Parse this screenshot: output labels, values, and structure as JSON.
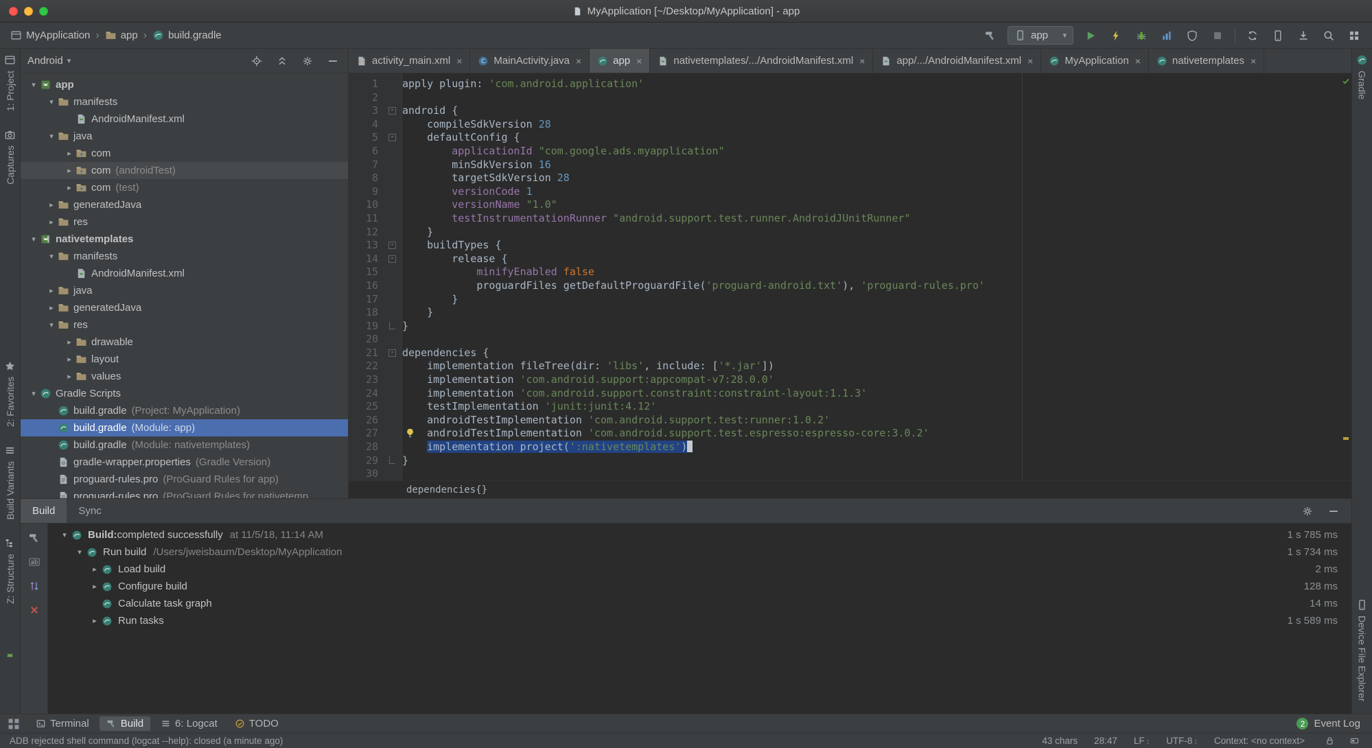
{
  "window": {
    "title": "MyApplication [~/Desktop/MyApplication] - app"
  },
  "colors": {
    "selection": "#214283",
    "tree_selection": "#4b6eaf",
    "run_green": "#5a9e60",
    "error_red": "#c75450",
    "event_badge": "#499c54",
    "string": "#6a8759",
    "keyword": "#cc7832"
  },
  "nav": {
    "crumbs": [
      {
        "label": "MyApplication",
        "icon": "window"
      },
      {
        "label": "app",
        "icon": "folder"
      },
      {
        "label": "build.gradle",
        "icon": "gradle"
      }
    ],
    "run_config": "app",
    "toolbar": [
      {
        "icon": "hammer",
        "name": "build"
      },
      {
        "type": "combo"
      },
      {
        "icon": "play",
        "name": "run"
      },
      {
        "icon": "lightning",
        "name": "apply-changes"
      },
      {
        "icon": "bug",
        "name": "debug"
      },
      {
        "icon": "profiler",
        "name": "profile"
      },
      {
        "icon": "shield",
        "name": "coverage"
      },
      {
        "icon": "stop",
        "name": "stop"
      },
      {
        "type": "sep"
      },
      {
        "icon": "sync",
        "name": "gradle-sync"
      },
      {
        "icon": "device",
        "name": "layout-inspector"
      },
      {
        "icon": "download",
        "name": "sdk-manager"
      },
      {
        "icon": "search",
        "name": "search-everywhere"
      },
      {
        "icon": "grid",
        "name": "project-structure"
      }
    ]
  },
  "left_stripe": {
    "items": [
      {
        "label": "1: Project",
        "icon": "window"
      },
      {
        "label": "Captures",
        "icon": "camera"
      },
      {
        "label": "2: Favorites",
        "icon": "star",
        "gap": true
      },
      {
        "label": "Build Variants",
        "icon": "list"
      },
      {
        "label": "Z: Structure",
        "icon": "structure"
      }
    ],
    "extra_icon": "robot"
  },
  "right_stripe": {
    "items": [
      {
        "label": "Gradle",
        "icon": "gradle"
      },
      {
        "label": "Device File Explorer",
        "icon": "device",
        "bottom": true
      }
    ]
  },
  "project": {
    "mode": "Android",
    "header_icons": [
      {
        "icon": "target",
        "name": "locate-file"
      },
      {
        "icon": "collapseall",
        "name": "collapse-all"
      },
      {
        "icon": "gear",
        "name": "view-options"
      },
      {
        "icon": "hidebar",
        "name": "hide-panel"
      }
    ],
    "tree": [
      {
        "label": "app",
        "icon": "android-module",
        "depth": 0,
        "arrow": "open",
        "bold": true
      },
      {
        "label": "manifests",
        "icon": "folder",
        "depth": 1,
        "arrow": "open"
      },
      {
        "label": "AndroidManifest.xml",
        "icon": "manifest",
        "depth": 2,
        "arrow": "none"
      },
      {
        "label": "java",
        "icon": "folder",
        "depth": 1,
        "arrow": "open"
      },
      {
        "label": "com",
        "icon": "package",
        "depth": 2,
        "arrow": "closed"
      },
      {
        "label": "com",
        "note": "(androidTest)",
        "icon": "package",
        "depth": 2,
        "arrow": "closed",
        "hl": true
      },
      {
        "label": "com",
        "note": "(test)",
        "icon": "package",
        "depth": 2,
        "arrow": "closed"
      },
      {
        "label": "generatedJava",
        "icon": "folder",
        "depth": 1,
        "arrow": "closed"
      },
      {
        "label": "res",
        "icon": "folder",
        "depth": 1,
        "arrow": "closed"
      },
      {
        "label": "nativetemplates",
        "icon": "library-module",
        "depth": 0,
        "arrow": "open",
        "bold": true
      },
      {
        "label": "manifests",
        "icon": "folder",
        "depth": 1,
        "arrow": "open"
      },
      {
        "label": "AndroidManifest.xml",
        "icon": "manifest",
        "depth": 2,
        "arrow": "none"
      },
      {
        "label": "java",
        "icon": "folder",
        "depth": 1,
        "arrow": "closed"
      },
      {
        "label": "generatedJava",
        "icon": "folder",
        "depth": 1,
        "arrow": "closed"
      },
      {
        "label": "res",
        "icon": "folder",
        "depth": 1,
        "arrow": "open"
      },
      {
        "label": "drawable",
        "icon": "folder",
        "depth": 2,
        "arrow": "closed"
      },
      {
        "label": "layout",
        "icon": "folder",
        "depth": 2,
        "arrow": "closed"
      },
      {
        "label": "values",
        "icon": "folder",
        "depth": 2,
        "arrow": "closed"
      },
      {
        "label": "Gradle Scripts",
        "icon": "gradle",
        "depth": 0,
        "arrow": "open"
      },
      {
        "label": "build.gradle",
        "note": "(Project: MyApplication)",
        "icon": "gradle",
        "depth": 1,
        "arrow": "none"
      },
      {
        "label": "build.gradle",
        "note": "(Module: app)",
        "icon": "gradle",
        "depth": 1,
        "arrow": "none",
        "selected": true
      },
      {
        "label": "build.gradle",
        "note": "(Module: nativetemplates)",
        "icon": "gradle",
        "depth": 1,
        "arrow": "none"
      },
      {
        "label": "gradle-wrapper.properties",
        "note": "(Gradle Version)",
        "icon": "wrapper",
        "depth": 1,
        "arrow": "none"
      },
      {
        "label": "proguard-rules.pro",
        "note": "(ProGuard Rules for app)",
        "icon": "profile",
        "depth": 1,
        "arrow": "none"
      },
      {
        "label": "proguard-rules.pro",
        "note": "(ProGuard Rules for nativetemp",
        "icon": "profile",
        "depth": 1,
        "arrow": "none"
      }
    ]
  },
  "editor": {
    "tabs": [
      {
        "label": "activity_main.xml",
        "icon": "xml"
      },
      {
        "label": "MainActivity.java",
        "icon": "java"
      },
      {
        "label": "app",
        "icon": "gradle",
        "active": true
      },
      {
        "label": "nativetemplates/.../AndroidManifest.xml",
        "icon": "manifest"
      },
      {
        "label": "app/.../AndroidManifest.xml",
        "icon": "manifest"
      },
      {
        "label": "MyApplication",
        "icon": "gradle"
      },
      {
        "label": "nativetemplates",
        "icon": "gradle"
      }
    ],
    "breadcrumb": "dependencies{}",
    "code": {
      "lines": [
        {
          "tok": [
            [
              "p",
              "apply plugin: "
            ],
            [
              "s",
              "'com.android.application'"
            ]
          ]
        },
        {
          "tok": []
        },
        {
          "tok": [
            [
              "p",
              "android {"
            ]
          ],
          "fold": true
        },
        {
          "tok": [
            [
              "p",
              "    compileSdkVersion "
            ],
            [
              "n",
              "28"
            ]
          ]
        },
        {
          "tok": [
            [
              "p",
              "    defaultConfig {"
            ]
          ],
          "fold": true
        },
        {
          "tok": [
            [
              "p",
              "        "
            ],
            [
              "f",
              "applicationId "
            ],
            [
              "s",
              "\"com.google.ads.myapplication\""
            ]
          ]
        },
        {
          "tok": [
            [
              "p",
              "        minSdkVersion "
            ],
            [
              "n",
              "16"
            ]
          ]
        },
        {
          "tok": [
            [
              "p",
              "        targetSdkVersion "
            ],
            [
              "n",
              "28"
            ]
          ]
        },
        {
          "tok": [
            [
              "p",
              "        "
            ],
            [
              "f",
              "versionCode "
            ],
            [
              "n",
              "1"
            ]
          ]
        },
        {
          "tok": [
            [
              "p",
              "        "
            ],
            [
              "f",
              "versionName "
            ],
            [
              "s",
              "\"1.0\""
            ]
          ]
        },
        {
          "tok": [
            [
              "p",
              "        "
            ],
            [
              "f",
              "testInstrumentationRunner "
            ],
            [
              "s",
              "\"android.support.test.runner.AndroidJUnitRunner\""
            ]
          ]
        },
        {
          "tok": [
            [
              "p",
              "    }"
            ]
          ]
        },
        {
          "tok": [
            [
              "p",
              "    buildTypes {"
            ]
          ],
          "fold": true
        },
        {
          "tok": [
            [
              "p",
              "        release {"
            ]
          ],
          "fold": true
        },
        {
          "tok": [
            [
              "p",
              "            "
            ],
            [
              "f",
              "minifyEnabled "
            ],
            [
              "k",
              "false"
            ]
          ]
        },
        {
          "tok": [
            [
              "p",
              "            proguardFiles getDefaultProguardFile("
            ],
            [
              "s",
              "'proguard-android.txt'"
            ],
            [
              "p",
              "), "
            ],
            [
              "s",
              "'proguard-rules.pro'"
            ]
          ]
        },
        {
          "tok": [
            [
              "p",
              "        }"
            ]
          ]
        },
        {
          "tok": [
            [
              "p",
              "    }"
            ]
          ]
        },
        {
          "tok": [
            [
              "p",
              "}"
            ]
          ],
          "foldEnd": true
        },
        {
          "tok": []
        },
        {
          "tok": [
            [
              "p",
              "dependencies {"
            ]
          ],
          "fold": true
        },
        {
          "tok": [
            [
              "p",
              "    implementation fileTree(dir: "
            ],
            [
              "s",
              "'libs'"
            ],
            [
              "p",
              ", include: ["
            ],
            [
              "s",
              "'*.jar'"
            ],
            [
              "p",
              "])"
            ]
          ]
        },
        {
          "tok": [
            [
              "p",
              "    implementation "
            ],
            [
              "s",
              "'com.android.support:appcompat-v7:28.0.0'"
            ]
          ]
        },
        {
          "tok": [
            [
              "p",
              "    implementation "
            ],
            [
              "s",
              "'com.android.support.constraint:constraint-layout:1.1.3'"
            ]
          ]
        },
        {
          "tok": [
            [
              "p",
              "    testImplementation "
            ],
            [
              "s",
              "'junit:junit:4.12'"
            ]
          ]
        },
        {
          "tok": [
            [
              "p",
              "    androidTestImplementation "
            ],
            [
              "s",
              "'com.android.support.test:runner:1.0.2'"
            ]
          ]
        },
        {
          "tok": [
            [
              "p",
              "    androidTestImplementation "
            ],
            [
              "s",
              "'com.android.support.test.espresso:espresso-core:3.0.2'"
            ]
          ],
          "bulb": true
        },
        {
          "tok": [
            [
              "p",
              "    "
            ],
            [
              "p",
              "implementation project("
            ],
            [
              "s",
              "':nativetemplates'"
            ],
            [
              "p",
              ")"
            ]
          ],
          "selFrom": 1,
          "caret": true
        },
        {
          "tok": [
            [
              "p",
              "}"
            ]
          ],
          "foldEnd": true
        },
        {
          "tok": []
        }
      ]
    }
  },
  "syntax_colors": {
    "p": "#a9b7c6",
    "k": "#cc7832",
    "s": "#6a8759",
    "n": "#6897bb",
    "f": "#9876aa"
  },
  "build": {
    "tabs": [
      "Build",
      "Sync"
    ],
    "header_icons": [
      {
        "icon": "gear",
        "name": "build-settings"
      },
      {
        "icon": "hidebar",
        "name": "hide-build-panel"
      }
    ],
    "side_icons": [
      {
        "icon": "hammer",
        "name": "restart-build"
      },
      {
        "icon": "abfilter",
        "name": "filter-messages"
      },
      {
        "icon": "updown",
        "name": "expand-collapse"
      },
      {
        "icon": "redx",
        "name": "close-build"
      }
    ],
    "rows": [
      {
        "depth": 0,
        "arrow": "open",
        "bold": "Build:",
        "label": " completed successfully",
        "detail": "at 11/5/18, 11:14 AM",
        "time": "1 s 785 ms"
      },
      {
        "depth": 1,
        "arrow": "open",
        "label": "Run build",
        "detail": "/Users/jweisbaum/Desktop/MyApplication",
        "time": "1 s 734 ms"
      },
      {
        "depth": 2,
        "arrow": "closed",
        "label": "Load build",
        "time": "2 ms"
      },
      {
        "depth": 2,
        "arrow": "closed",
        "label": "Configure build",
        "time": "128 ms"
      },
      {
        "depth": 2,
        "arrow": "none",
        "label": "Calculate task graph",
        "time": "14 ms"
      },
      {
        "depth": 2,
        "arrow": "closed",
        "label": "Run tasks",
        "time": "1 s 589 ms"
      }
    ]
  },
  "bottom": {
    "tabs": [
      {
        "label": "Terminal",
        "icon": "terminal"
      },
      {
        "label": "Build",
        "icon": "hammer",
        "active": true
      },
      {
        "label": "6: Logcat",
        "icon": "list"
      },
      {
        "label": "TODO",
        "icon": "todo"
      }
    ],
    "event_count": "2",
    "event_label": "Event Log"
  },
  "status": {
    "message": "ADB rejected shell command (logcat --help): closed (a minute ago)",
    "chars": "43 chars",
    "caret_pos": "28:47",
    "line_ending": "LF",
    "encoding": "UTF-8",
    "context": "Context: <no context>",
    "icons": [
      {
        "icon": "lock",
        "name": "readonly-toggle"
      },
      {
        "icon": "indicator",
        "name": "screen-reader-indicator"
      }
    ]
  }
}
